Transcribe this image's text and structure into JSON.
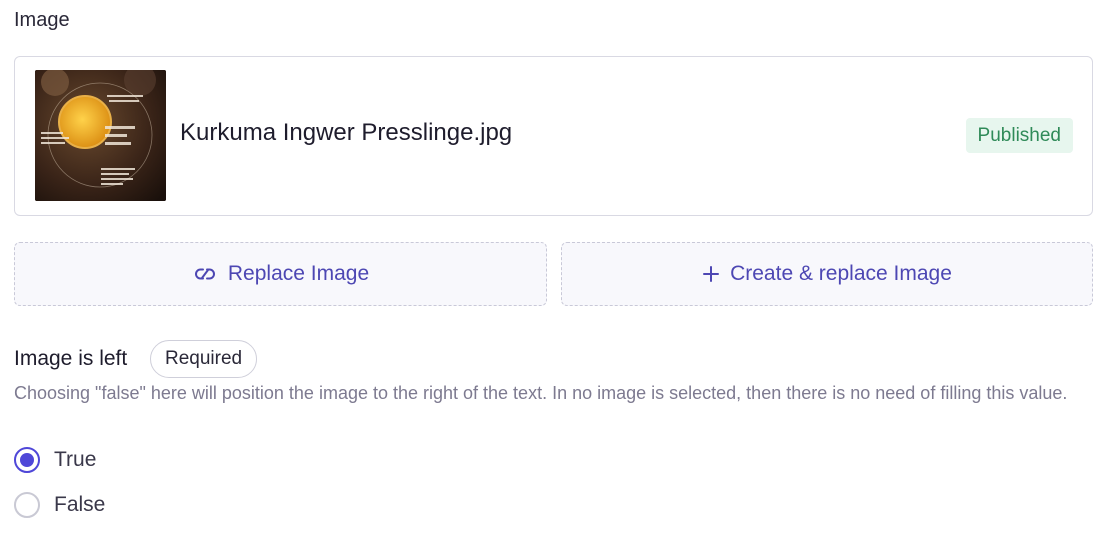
{
  "section": {
    "label": "Image"
  },
  "image": {
    "file_name": "Kurkuma Ingwer Presslinge.jpg",
    "status": "Published",
    "thumbnail_icon": "image-thumbnail"
  },
  "actions": {
    "replace_label": "Replace Image",
    "replace_icon": "link-icon",
    "create_label": "Create & replace Image",
    "create_icon": "plus-icon"
  },
  "field": {
    "label": "Image is left",
    "required_label": "Required",
    "help": "Choosing \"false\" here will position the image to the right of the text. In no image is selected, then there is no need of filling this value.",
    "options": [
      {
        "label": "True",
        "checked": true
      },
      {
        "label": "False",
        "checked": false
      }
    ]
  },
  "colors": {
    "accent": "#4f47d8",
    "published_bg": "#e7f6ee",
    "published_text": "#2f8a58"
  }
}
